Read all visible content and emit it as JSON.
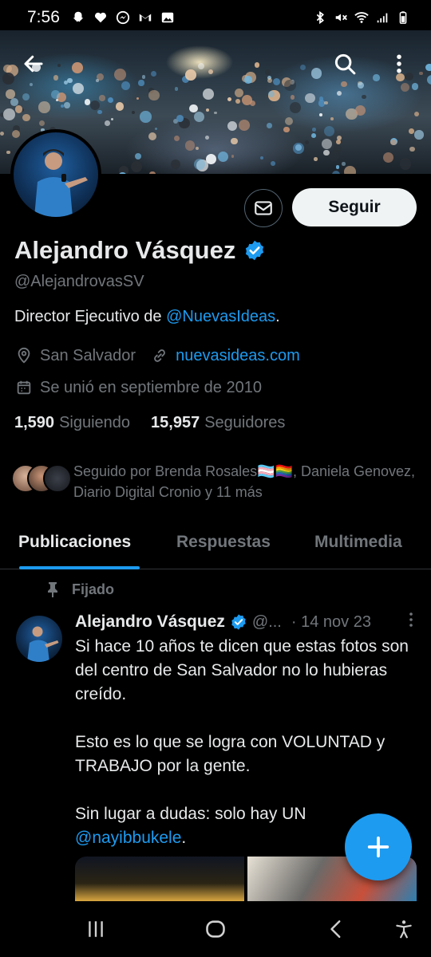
{
  "status_bar": {
    "time": "7:56"
  },
  "profile": {
    "name": "Alejandro Vásquez",
    "handle": "@AlejandrovasSV",
    "bio_prefix": "Director Ejecutivo de ",
    "bio_mention": "@NuevasIdeas",
    "bio_suffix": ".",
    "location": "San Salvador",
    "website": "nuevasideas.com",
    "joined": "Se unió en septiembre de 2010",
    "following_count": "1,590",
    "following_label": "Siguiendo",
    "followers_count": "15,957",
    "followers_label": "Seguidores",
    "followed_by_text": "Seguido por Brenda Rosales🏳️‍⚧️🏳️‍🌈, Daniela Genovez, Diario Digital Cronio y 11 más"
  },
  "actions": {
    "follow_label": "Seguir"
  },
  "tabs": [
    {
      "label": "Publicaciones",
      "active": true
    },
    {
      "label": "Respuestas",
      "active": false
    },
    {
      "label": "Multimedia",
      "active": false
    }
  ],
  "tweet": {
    "pinned_label": "Fijado",
    "author": "Alejandro Vásquez",
    "handle": "@...",
    "date": "· 14 nov 23",
    "line1": "Si hace 10 años te dicen que estas fotos son del centro de San Salvador no lo hubieras creído.",
    "line2": "Esto es lo que se logra con VOLUNTAD y TRABAJO por la gente.",
    "line3_prefix": "Sin lugar a dudas: solo hay UN ",
    "line3_mention": "@nayibbukele",
    "line3_suffix": "."
  },
  "colors": {
    "accent": "#1d9bf0",
    "background": "#000000",
    "text": "#e7e9ea",
    "muted": "#71767b"
  },
  "icons": [
    "back-arrow-icon",
    "search-icon",
    "more-vertical-icon",
    "mail-icon",
    "verified-badge-icon",
    "location-icon",
    "link-icon",
    "calendar-icon",
    "pin-icon",
    "compose-plus-icon",
    "recents-icon",
    "home-icon",
    "back-icon",
    "accessibility-icon"
  ]
}
